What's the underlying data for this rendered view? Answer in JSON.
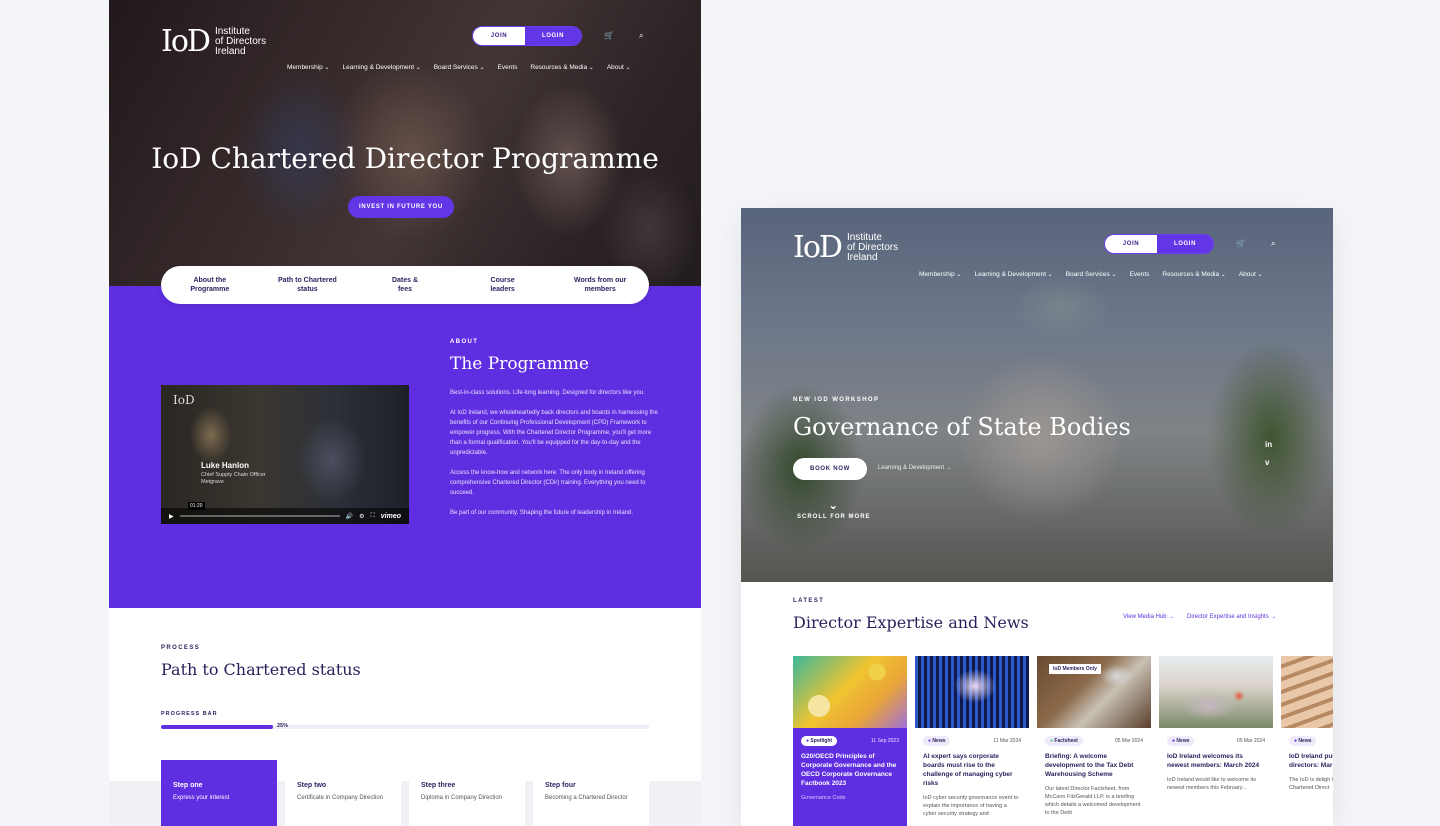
{
  "brand": {
    "logo_mark": "IoD",
    "logo_text": [
      "Institute",
      "of Directors",
      "Ireland"
    ],
    "purple": "#5f2ee0",
    "navy": "#2a1f5c"
  },
  "header": {
    "join": "JOIN IOD",
    "login": "LOGIN",
    "cart_icon": "cart-icon",
    "search_icon": "search-icon",
    "nav": [
      "Membership",
      "Learning & Development",
      "Board Services",
      "Events",
      "Resources & Media",
      "About"
    ]
  },
  "left": {
    "hero_title": "IoD Chartered Director Programme",
    "hero_button": "INVEST IN FUTURE YOU",
    "tabs": [
      "About the\nProgramme",
      "Path to Chartered\nstatus",
      "Dates &\nfees",
      "Course\nleaders",
      "Words from our\nmembers"
    ],
    "video": {
      "name": "Luke Hanlon",
      "role": "Chief Supply Chain Officer\nMetgrave",
      "time": "01:20",
      "brand": "vimeo"
    },
    "about": {
      "label": "ABOUT",
      "title": "The Programme",
      "paragraphs": [
        "Best-in-class solutions. Life-long learning. Designed for directors like you.",
        "At IoD Ireland, we wholeheartedly back directors and boards in harnessing the benefits of our Continuing Professional Development (CPD) Framework to empower progress. With the Chartered Director Programme, you'll get more than a formal qualification. You'll be equipped for the day-to-day and the unpredictable.",
        "Access the know-how and network here. The only body in Ireland offering comprehensive Chartered Director (CDir) training. Everything you need to succeed.",
        "Be part of our community. Shaping the future of leadership in Ireland."
      ]
    },
    "process": {
      "label": "PROCESS",
      "title": "Path to Chartered status",
      "progress_label": "PROGRESS BAR",
      "progress_pct": "25%",
      "progress_value": 0.23,
      "steps": [
        {
          "title": "Step one",
          "desc": "Express your interest"
        },
        {
          "title": "Step two",
          "desc": "Certificate in Company Direction"
        },
        {
          "title": "Step three",
          "desc": "Diploma in Company Direction"
        },
        {
          "title": "Step four",
          "desc": "Becoming a Chartered Director"
        }
      ]
    }
  },
  "right": {
    "eyebrow": "NEW IOD WORKSHOP",
    "hero_title": "Governance of State Bodies",
    "book": "BOOK NOW",
    "crumb": "Learning & Development →",
    "scroll": "SCROLL FOR MORE",
    "social": [
      "in",
      "v"
    ],
    "latest_label": "LATEST",
    "latest_title": "Director Expertise and News",
    "links": [
      "View Media Hub →",
      "Director Expertise and Insights →"
    ],
    "cards": [
      {
        "tag": "Spotlight",
        "date": "11 Sep 2023",
        "title": "G20/OECD Principles of Corporate Governance and the OECD Corporate Governance Factbook 2023",
        "desc": "Governance Code"
      },
      {
        "tag": "News",
        "date": "11 Mar 2024",
        "title": "AI expert says corporate boards must rise to the challenge of managing cyber risks",
        "desc": "IoD cyber security governance event to explain the importance of having a cyber security strategy and"
      },
      {
        "tag": "Factsheet",
        "date": "05 Mar 2024",
        "title": "Briefing: A welcome development to the Tax Debt Warehousing Scheme",
        "desc": "Our latest Director Factsheet, from McCann FitzGerald LLP, is a briefing which details a welcomed development to the Debt",
        "members_only": "IoD Members Only"
      },
      {
        "tag": "News",
        "date": "05 Mar 2024",
        "title": "IoD Ireland welcomes its newest members: March 2024",
        "desc": "IoD Ireland would like to welcome its newest members this February..."
      },
      {
        "tag": "News",
        "date": "",
        "title": "IoD Ireland pul of qualified ch directors: Mar",
        "desc": "The IoD is deligh latest list of rece Chartered Direct"
      }
    ]
  }
}
